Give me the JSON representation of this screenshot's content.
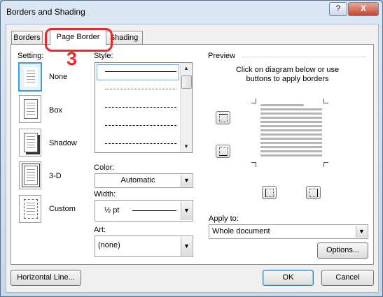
{
  "window": {
    "title": "Borders and Shading",
    "help_label": "?",
    "close_label": "X"
  },
  "tabs": [
    {
      "label": "Borders",
      "active": false
    },
    {
      "label": "Page Border",
      "active": true
    },
    {
      "label": "Shading",
      "active": false
    }
  ],
  "annotation": {
    "step_number": "3",
    "color": "#e8282a"
  },
  "setting": {
    "label": "Setting:",
    "options": [
      {
        "label": "None",
        "selected": true
      },
      {
        "label": "Box",
        "selected": false
      },
      {
        "label": "Shadow",
        "selected": false
      },
      {
        "label": "3-D",
        "selected": false
      },
      {
        "label": "Custom",
        "selected": false
      }
    ]
  },
  "style": {
    "label": "Style:"
  },
  "color": {
    "label": "Color:",
    "value": "Automatic"
  },
  "width": {
    "label": "Width:",
    "value": "½ pt"
  },
  "art": {
    "label": "Art:",
    "value": "(none)"
  },
  "preview": {
    "label": "Preview",
    "instruction_line1": "Click on diagram below or use",
    "instruction_line2": "buttons to apply borders"
  },
  "apply_to": {
    "label": "Apply to:",
    "value": "Whole document"
  },
  "buttons": {
    "options": "Options...",
    "horizontal_line": "Horizontal Line...",
    "ok": "OK",
    "cancel": "Cancel"
  },
  "colors": {
    "selection_accent": "#39a0d8",
    "title_bar": "#c6d7ea"
  }
}
